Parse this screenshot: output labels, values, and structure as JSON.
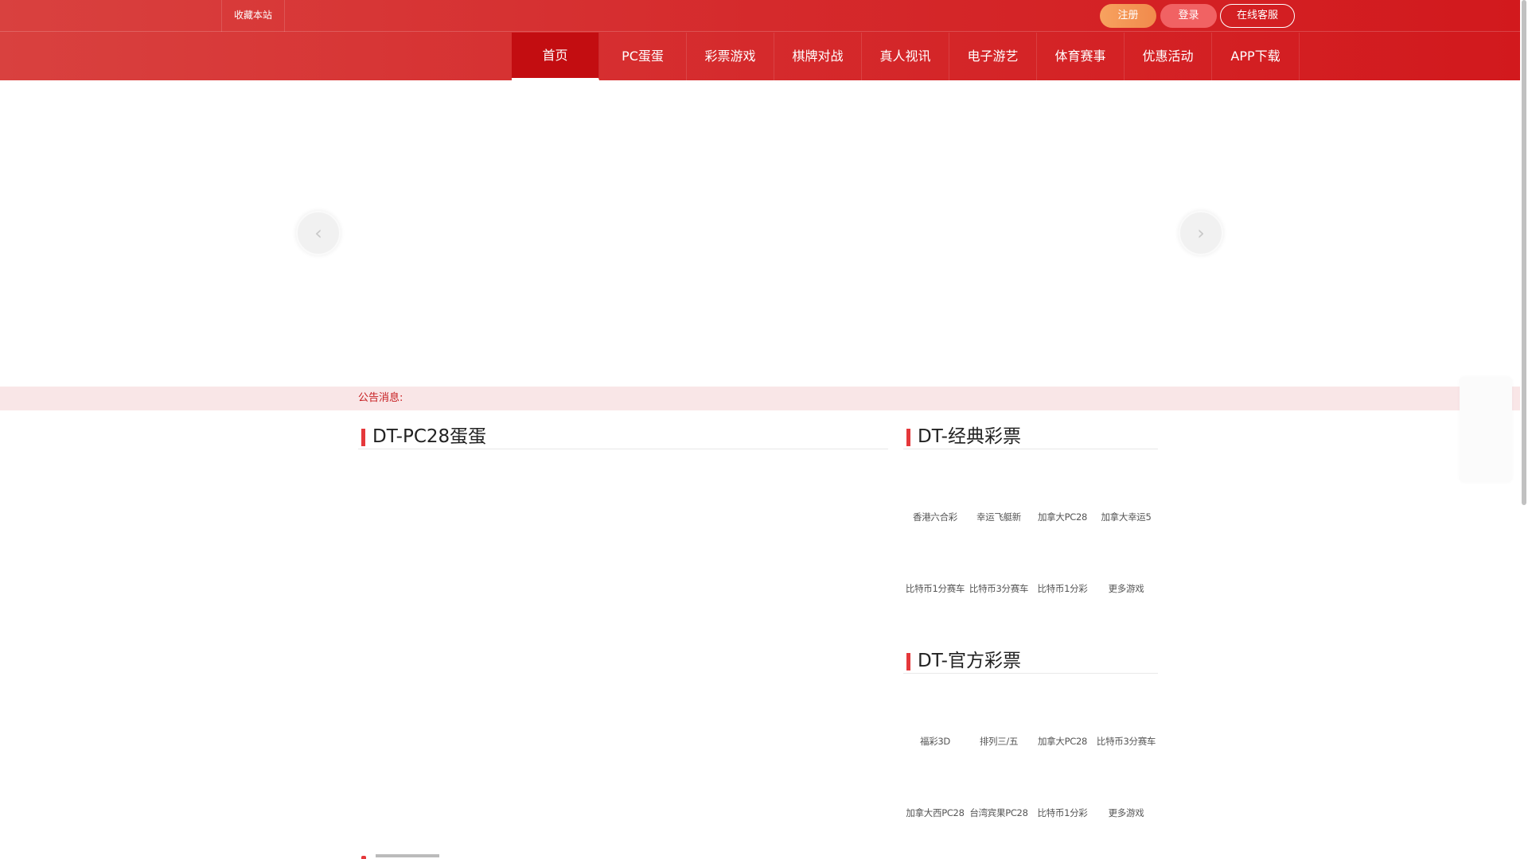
{
  "topbar": {
    "bookmark_label": "收藏本站",
    "register_label": "注册",
    "login_label": "登录",
    "service_label": "在线客服"
  },
  "nav": {
    "items": [
      "首页",
      "PC蛋蛋",
      "彩票游戏",
      "棋牌对战",
      "真人视讯",
      "电子游艺",
      "体育赛事",
      "优惠活动",
      "APP下载"
    ],
    "active_index": 0
  },
  "banner": {
    "prev_icon": "chevron-left-icon",
    "next_icon": "chevron-right-icon"
  },
  "notice": {
    "label": "公告消息:"
  },
  "sections": {
    "pc28": {
      "title": "DT-PC28蛋蛋"
    },
    "classic": {
      "title": "DT-经典彩票",
      "games": [
        "香港六合彩",
        "幸运飞艇新",
        "加拿大PC28",
        "加拿大幸运5",
        "比特币1分赛车",
        "比特币3分赛车",
        "比特币1分彩",
        "更多游戏"
      ]
    },
    "official": {
      "title": "DT-官方彩票",
      "games": [
        "福彩3D",
        "排列三/五",
        "加拿大PC28",
        "比特币3分赛车",
        "加拿大西PC28",
        "台湾宾果PC28",
        "比特币1分彩",
        "更多游戏"
      ]
    }
  },
  "colors": {
    "header_red": "#d2191d",
    "accent_red": "#e5383b",
    "notice_bg": "#f9e6e7",
    "register_orange": "#f18a4c",
    "login_pink": "#f16263"
  }
}
